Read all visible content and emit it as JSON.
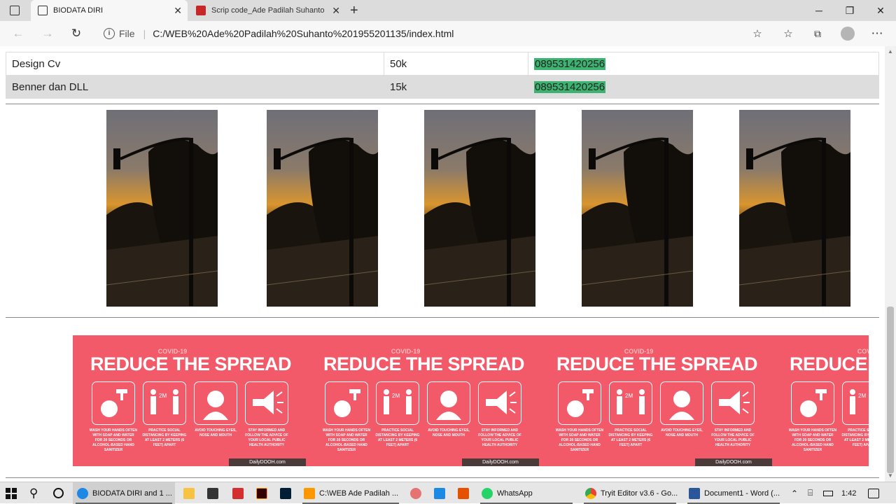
{
  "browser": {
    "tabs": [
      {
        "label": "BIODATA DIRI",
        "active": true
      },
      {
        "label": "Scrip code_Ade Padilah Suhanto",
        "active": false
      }
    ],
    "url_prefix": "File",
    "url": "C:/WEB%20Ade%20Padilah%20Suhanto%201955201135/index.html",
    "new_tab_glyph": "+"
  },
  "price_table": {
    "rows": [
      {
        "service": "Design Cv",
        "price": "50k",
        "contact": "089531420256"
      },
      {
        "service": "Benner dan DLL",
        "price": "15k",
        "contact": "089531420256"
      }
    ]
  },
  "banner": {
    "kicker": "COVID-19",
    "title": "REDUCE THE SPREAD",
    "captions": [
      "WASH YOUR HANDS OFTEN WITH SOAP AND WATER FOR 20 SECONDS OR ALCOHOL-BASED HAND SANITIZER",
      "PRACTICE SOCIAL DISTANCING BY KEEPING AT LEAST 2 METERS (6 FEET) APART",
      "AVOID TOUCHING EYES, NOSE AND MOUTH",
      "STAY INFORMED AND FOLLOW THE ADVICE OF YOUR LOCAL PUBLIC HEALTH AUTHORITY"
    ],
    "distance_label": "2M",
    "brand": "DailyDOOH.com"
  },
  "taskbar": {
    "items": [
      {
        "label": "BIODATA DIRI and 1 ...",
        "icon": "edge-icon"
      },
      {
        "label": "C:\\WEB Ade Padilah ...",
        "icon": "sublime-icon"
      },
      {
        "label": "WhatsApp",
        "icon": "whatsapp-icon"
      },
      {
        "label": "Tryit Editor v3.6 - Go...",
        "icon": "chrome-icon"
      },
      {
        "label": "Document1 - Word (...",
        "icon": "word-icon"
      }
    ],
    "time": "1:42"
  },
  "colors": {
    "phone_highlight": "#3cb371",
    "banner": "#f25a6a",
    "alt_row": "#dddddd"
  }
}
